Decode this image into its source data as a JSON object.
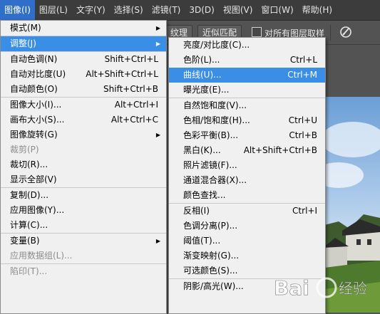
{
  "menubar": {
    "items": [
      {
        "label": "图像(I)",
        "active": true
      },
      {
        "label": "图层(L)",
        "active": false
      },
      {
        "label": "文字(Y)",
        "active": false
      },
      {
        "label": "选择(S)",
        "active": false
      },
      {
        "label": "滤镜(T)",
        "active": false
      },
      {
        "label": "3D(D)",
        "active": false
      },
      {
        "label": "视图(V)",
        "active": false
      },
      {
        "label": "窗口(W)",
        "active": false
      },
      {
        "label": "帮助(H)",
        "active": false
      }
    ]
  },
  "options": {
    "texture_label": "纹理",
    "approx_match_label": "近似匹配",
    "sample_all_layers_label": "对所有图层取样",
    "brush_icon": "brush-pressure-icon"
  },
  "image_menu": {
    "items": [
      {
        "type": "item",
        "label": "模式(M)",
        "shortcut": "",
        "submenu": true
      },
      {
        "type": "sep"
      },
      {
        "type": "item",
        "label": "调整(J)",
        "shortcut": "",
        "submenu": true,
        "highlight": true
      },
      {
        "type": "sep"
      },
      {
        "type": "item",
        "label": "自动色调(N)",
        "shortcut": "Shift+Ctrl+L"
      },
      {
        "type": "item",
        "label": "自动对比度(U)",
        "shortcut": "Alt+Shift+Ctrl+L"
      },
      {
        "type": "item",
        "label": "自动颜色(O)",
        "shortcut": "Shift+Ctrl+B"
      },
      {
        "type": "sep"
      },
      {
        "type": "item",
        "label": "图像大小(I)...",
        "shortcut": "Alt+Ctrl+I"
      },
      {
        "type": "item",
        "label": "画布大小(S)...",
        "shortcut": "Alt+Ctrl+C"
      },
      {
        "type": "item",
        "label": "图像旋转(G)",
        "shortcut": "",
        "submenu": true
      },
      {
        "type": "item",
        "label": "裁剪(P)",
        "shortcut": "",
        "disabled": true
      },
      {
        "type": "item",
        "label": "裁切(R)...",
        "shortcut": ""
      },
      {
        "type": "item",
        "label": "显示全部(V)",
        "shortcut": ""
      },
      {
        "type": "sep"
      },
      {
        "type": "item",
        "label": "复制(D)...",
        "shortcut": ""
      },
      {
        "type": "item",
        "label": "应用图像(Y)...",
        "shortcut": ""
      },
      {
        "type": "item",
        "label": "计算(C)...",
        "shortcut": ""
      },
      {
        "type": "sep"
      },
      {
        "type": "item",
        "label": "变量(B)",
        "shortcut": "",
        "submenu": true
      },
      {
        "type": "item",
        "label": "应用数据组(L)...",
        "shortcut": "",
        "disabled": true
      },
      {
        "type": "sep"
      },
      {
        "type": "item",
        "label": "陷印(T)...",
        "shortcut": "",
        "disabled": true
      }
    ]
  },
  "adjust_menu": {
    "items": [
      {
        "type": "item",
        "label": "亮度/对比度(C)...",
        "shortcut": ""
      },
      {
        "type": "item",
        "label": "色阶(L)...",
        "shortcut": "Ctrl+L"
      },
      {
        "type": "item",
        "label": "曲线(U)...",
        "shortcut": "Ctrl+M",
        "highlight": true
      },
      {
        "type": "item",
        "label": "曝光度(E)...",
        "shortcut": ""
      },
      {
        "type": "sep"
      },
      {
        "type": "item",
        "label": "自然饱和度(V)...",
        "shortcut": ""
      },
      {
        "type": "item",
        "label": "色相/饱和度(H)...",
        "shortcut": "Ctrl+U"
      },
      {
        "type": "item",
        "label": "色彩平衡(B)...",
        "shortcut": "Ctrl+B"
      },
      {
        "type": "item",
        "label": "黑白(K)...",
        "shortcut": "Alt+Shift+Ctrl+B"
      },
      {
        "type": "item",
        "label": "照片滤镜(F)...",
        "shortcut": ""
      },
      {
        "type": "item",
        "label": "通道混合器(X)...",
        "shortcut": ""
      },
      {
        "type": "item",
        "label": "颜色查找...",
        "shortcut": ""
      },
      {
        "type": "sep"
      },
      {
        "type": "item",
        "label": "反相(I)",
        "shortcut": "Ctrl+I"
      },
      {
        "type": "item",
        "label": "色调分离(P)...",
        "shortcut": ""
      },
      {
        "type": "item",
        "label": "阈值(T)...",
        "shortcut": ""
      },
      {
        "type": "item",
        "label": "渐变映射(G)...",
        "shortcut": ""
      },
      {
        "type": "item",
        "label": "可选颜色(S)...",
        "shortcut": ""
      },
      {
        "type": "sep"
      },
      {
        "type": "item",
        "label": "阴影/高光(W)...",
        "shortcut": ""
      }
    ]
  },
  "watermark": {
    "text": "Bai",
    "suffix": "经验"
  },
  "colors": {
    "highlight": "#3a8ee6",
    "menubar_active": "#2f6ec9"
  }
}
